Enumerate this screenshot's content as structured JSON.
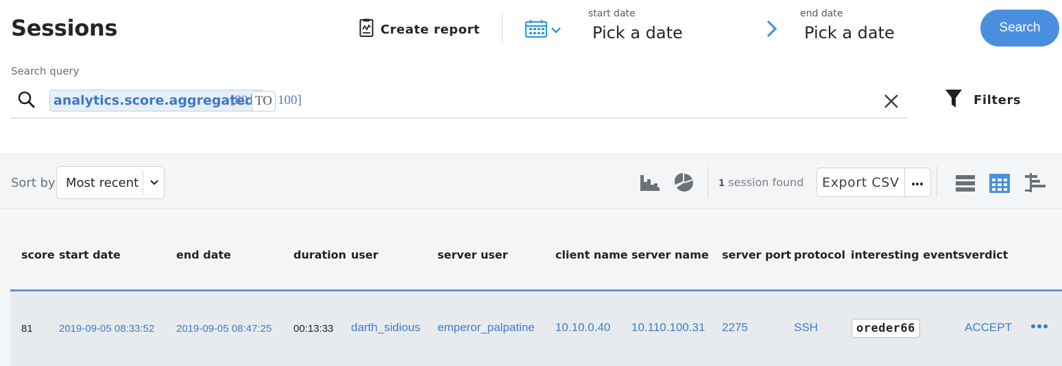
{
  "header": {
    "title": "Sessions",
    "create_report": "Create report",
    "start_date_label": "start date",
    "start_date_value": "Pick a date",
    "end_date_label": "end date",
    "end_date_value": "Pick a date",
    "search_button": "Search"
  },
  "query": {
    "label": "Search query",
    "field_token": "analytics.score.aggregated:",
    "range_open": "[80",
    "range_operator": "TO",
    "range_close": "100]",
    "filters_label": "Filters"
  },
  "toolbar": {
    "sort_label": "Sort by",
    "sort_value": "Most recent",
    "session_count": "1",
    "session_count_suffix": "session found",
    "export_csv": "Export CSV"
  },
  "table": {
    "columns": [
      "score",
      "start date",
      "end date",
      "duration",
      "user",
      "server user",
      "client name",
      "server name",
      "server port",
      "protocol",
      "interesting events",
      "verdict"
    ],
    "rows": [
      {
        "score": "81",
        "start_date": "2019-09-05 08:33:52",
        "end_date": "2019-09-05 08:47:25",
        "duration": "00:13:33",
        "user": "darth_sidious",
        "server_user": "emperor_palpatine",
        "client_name": "10.10.0.40",
        "server_name": "10.110.100.31",
        "server_port": "2275",
        "protocol": "SSH",
        "interesting_events": "oreder66",
        "verdict": "ACCEPT"
      }
    ]
  },
  "colors": {
    "accent": "#4a8fdf",
    "link": "#3f7bc9",
    "row_highlight": "#5a94dd",
    "toolbar_bg": "#f4f5f6"
  },
  "icons": {
    "report": "report-icon",
    "calendar": "calendar-icon",
    "next": "chevron-right-icon",
    "search": "search-icon",
    "clear": "close-icon",
    "filter": "filter-icon",
    "histogram": "histogram-icon",
    "pie": "pie-chart-icon",
    "more": "more-horizontal-icon",
    "list_view": "list-view-icon",
    "grid_view": "grid-view-icon",
    "timeline_view": "timeline-view-icon"
  }
}
